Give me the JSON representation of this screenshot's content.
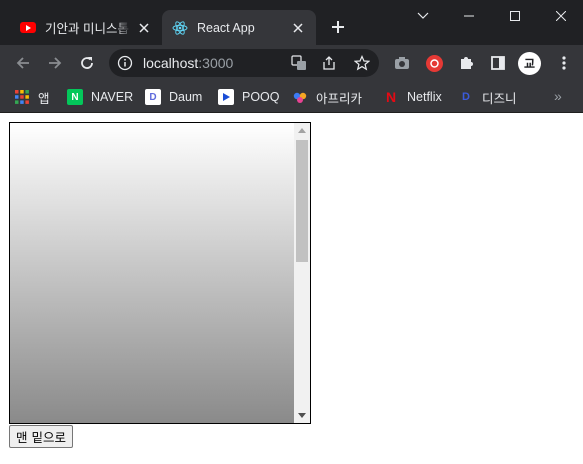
{
  "window": {
    "minimize_icon": "minimize-icon",
    "maximize_icon": "maximize-icon",
    "close_icon": "close-icon",
    "tab_search_icon": "chevron-down-icon"
  },
  "tabs": [
    {
      "title": "기안과 미니스톱",
      "favicon": "youtube-icon",
      "active": false
    },
    {
      "title": "React App",
      "favicon": "react-icon",
      "active": true
    }
  ],
  "toolbar": {
    "url_host": "localhost",
    "url_port": ":3000",
    "profile_initial": "교",
    "icons": [
      "back-arrow-icon",
      "forward-arrow-icon",
      "reload-icon",
      "info-icon",
      "translate-icon",
      "share-icon",
      "star-icon",
      "camera-icon",
      "extension-icon",
      "puzzle-icon",
      "side-panel-icon",
      "more-icon"
    ]
  },
  "bookmarks": [
    {
      "label": "앱",
      "icon": "apps-grid-icon"
    },
    {
      "label": "NAVER",
      "icon": "naver-icon",
      "color": "#03c75a"
    },
    {
      "label": "Daum",
      "icon": "daum-icon"
    },
    {
      "label": "POOQ",
      "icon": "pooq-icon"
    },
    {
      "label": "아프리카",
      "icon": "afreeca-icon"
    },
    {
      "label": "Netflix",
      "icon": "netflix-icon",
      "color": "#e50914"
    },
    {
      "label": "디즈니",
      "icon": "disney-icon"
    }
  ],
  "page": {
    "scroll_position": 0,
    "button_label": "맨 밑으로"
  }
}
